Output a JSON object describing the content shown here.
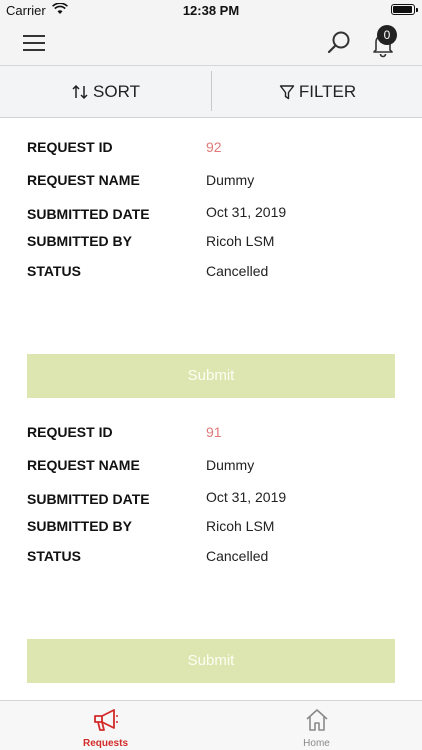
{
  "status_bar": {
    "carrier": "Carrier",
    "time": "12:38 PM"
  },
  "header": {
    "notification_count": "0"
  },
  "toolbar": {
    "sort_label": "SORT",
    "filter_label": "FILTER"
  },
  "labels": {
    "request_id": "REQUEST ID",
    "request_name": "REQUEST NAME",
    "submitted_date": "SUBMITTED DATE",
    "submitted_by": "SUBMITTED BY",
    "status": "STATUS"
  },
  "requests": [
    {
      "id": "92",
      "name": "Dummy",
      "submitted_date": "Oct 31, 2019",
      "submitted_by": "Ricoh LSM",
      "status": "Cancelled",
      "submit_label": "Submit"
    },
    {
      "id": "91",
      "name": "Dummy",
      "submitted_date": "Oct 31, 2019",
      "submitted_by": "Ricoh LSM",
      "status": "Cancelled",
      "submit_label": "Submit"
    }
  ],
  "tabs": [
    {
      "label": "Requests",
      "icon": "megaphone-icon",
      "active": true
    },
    {
      "label": "Home",
      "icon": "home-icon",
      "active": false
    }
  ],
  "colors": {
    "accent": "#d32a2a",
    "request_id": "#e07a7a",
    "submit_button": "#dde6b0"
  }
}
